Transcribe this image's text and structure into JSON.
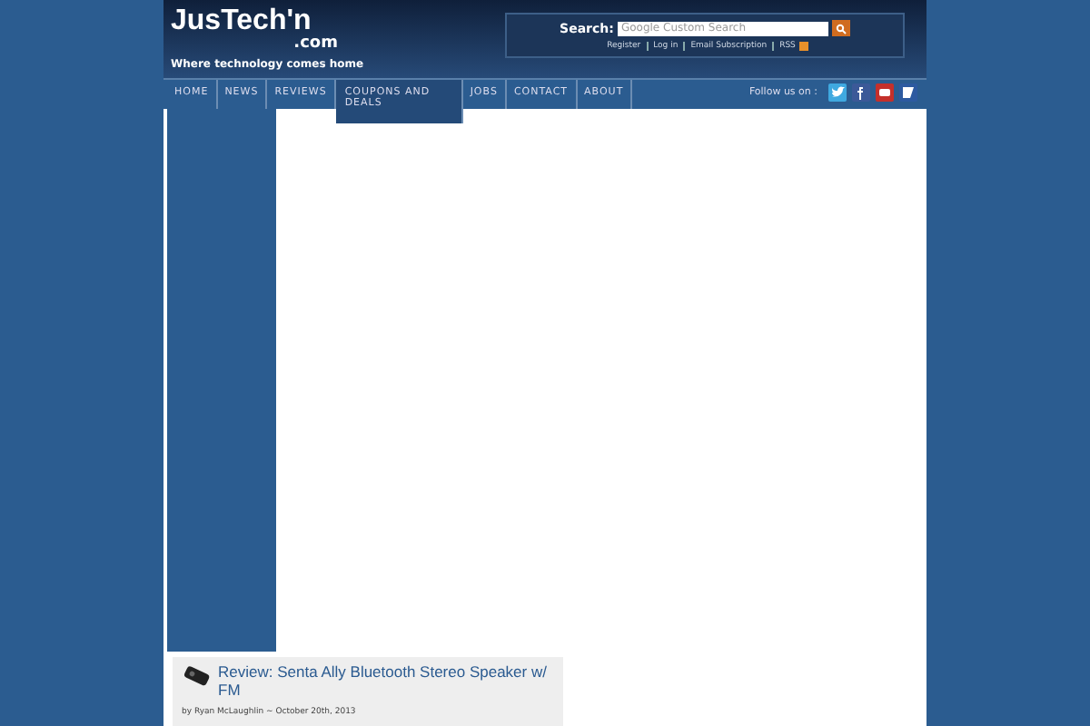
{
  "logo": {
    "name": "JusTech'n",
    "suffix": ".com",
    "tagline": "Where technology comes home"
  },
  "search": {
    "label": "Search:",
    "placeholder": "Google Custom Search",
    "links": [
      "Register",
      "Log in",
      "Email Subscription",
      "RSS"
    ]
  },
  "nav": {
    "items": [
      {
        "label": "HOME",
        "selected": false
      },
      {
        "label": "NEWS",
        "selected": false
      },
      {
        "label": "REVIEWS",
        "selected": false
      },
      {
        "label": "COUPONS AND DEALS",
        "selected": true
      },
      {
        "label": "JOBS",
        "selected": false
      },
      {
        "label": "CONTACT",
        "selected": false
      },
      {
        "label": "ABOUT",
        "selected": false
      }
    ],
    "follow_label": "Follow us on :",
    "social": [
      {
        "kind": "bird",
        "color": "#3fa9e0"
      },
      {
        "kind": "f",
        "color": "#3b5998"
      },
      {
        "kind": "tube",
        "color": "#c4302b"
      },
      {
        "kind": "square",
        "color": "#2d5aa0"
      }
    ]
  },
  "post": {
    "title": "Review: Senta Ally Bluetooth Stereo Speaker w/ FM",
    "byline": "by Ryan McLaughlin ~ October 20th, 2013"
  }
}
